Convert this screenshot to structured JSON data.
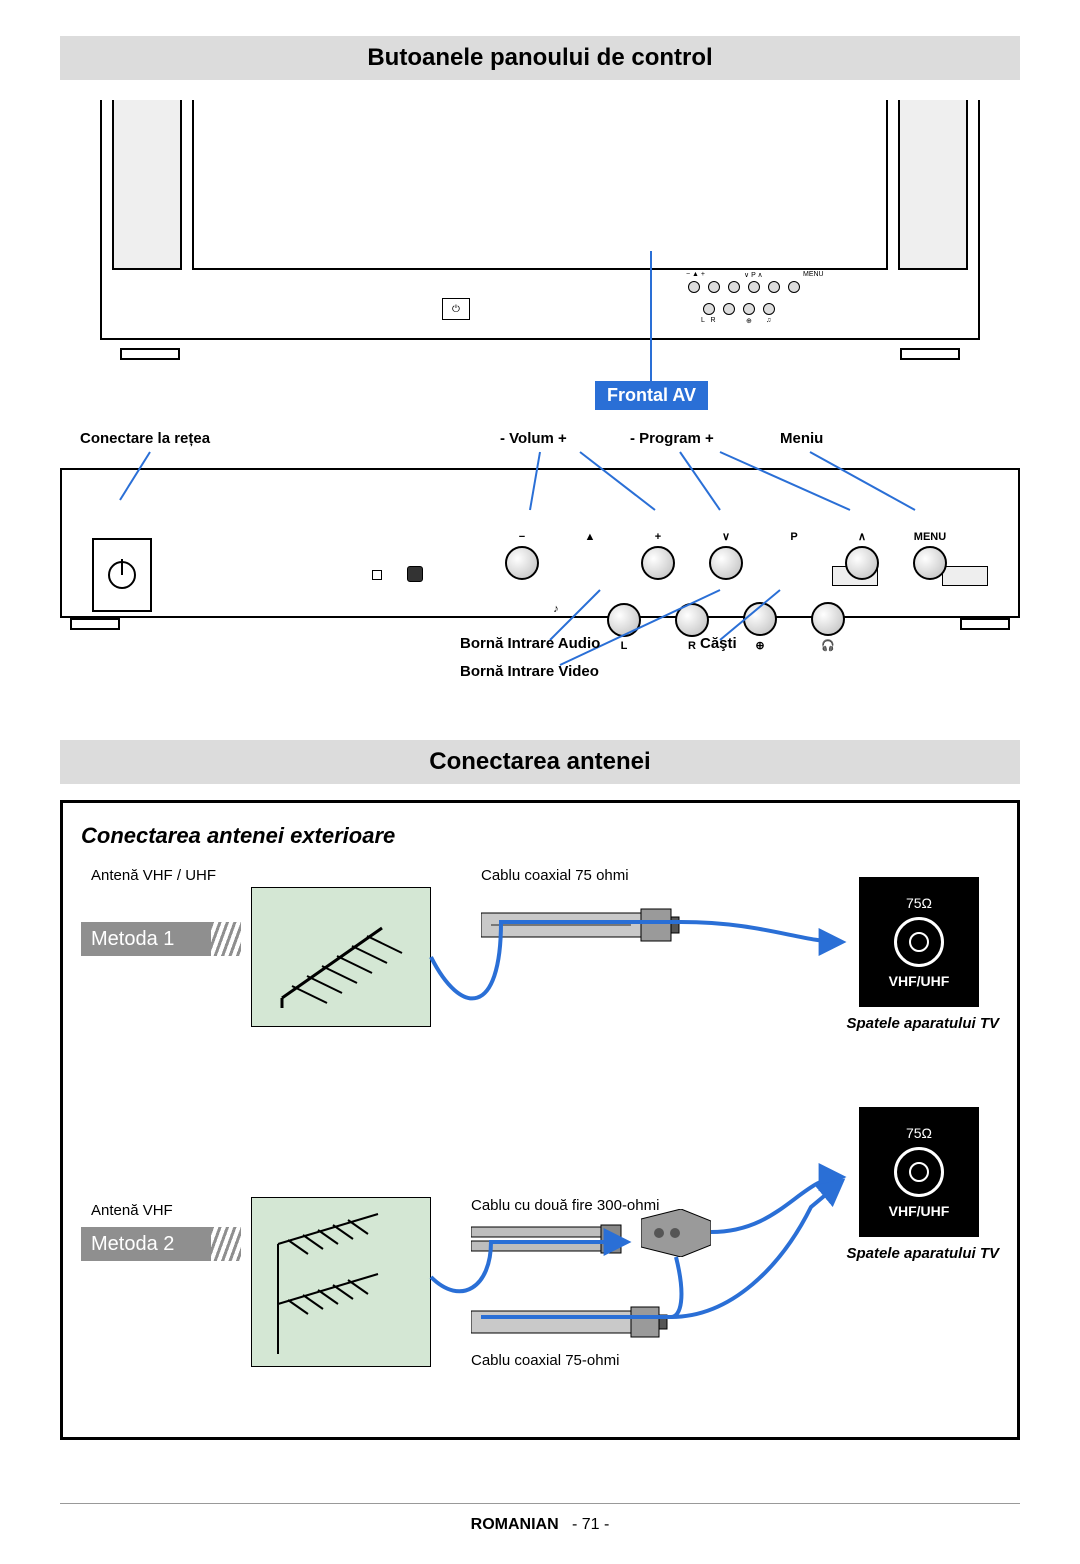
{
  "headings": {
    "panel": "Butoanele panoului de control",
    "antenna": "Conectarea antenei"
  },
  "frontal_av": "Frontal AV",
  "panel_top_labels": {
    "power": "Conectare la rețea",
    "volume": "- Volum +",
    "program": "- Program +",
    "menu": "Meniu"
  },
  "panel_button_symbols": {
    "vol_minus": "−",
    "vol_plus": "+",
    "prog_down": "∨",
    "prog_mid": "P",
    "prog_up": "∧",
    "menu": "MENU",
    "audio_sym": "♪",
    "l": "L",
    "r": "R",
    "video": "⊕",
    "hp": "♫"
  },
  "panel_bottom_labels": {
    "audio_in": "Bornă Intrare Audio",
    "video_in": "Bornă Intrare Video",
    "headphones": "Căşti"
  },
  "antenna": {
    "subheading": "Conectarea antenei exterioare",
    "method1": "Metoda 1",
    "method2": "Metoda 2",
    "ant_vhf_uhf": "Antenă VHF / UHF",
    "ant_vhf": "Antenă VHF",
    "coax_75": "Cablu coaxial 75 ohmi",
    "twin_300": "Cablu cu două fire 300-ohmi",
    "coax_75b": "Cablu coaxial 75-ohmi",
    "back_75": "75Ω",
    "back_band": "VHF/UHF",
    "tv_back": "Spatele aparatului TV"
  },
  "footer": {
    "lang": "ROMANIAN",
    "sep": "-",
    "page": "71"
  }
}
